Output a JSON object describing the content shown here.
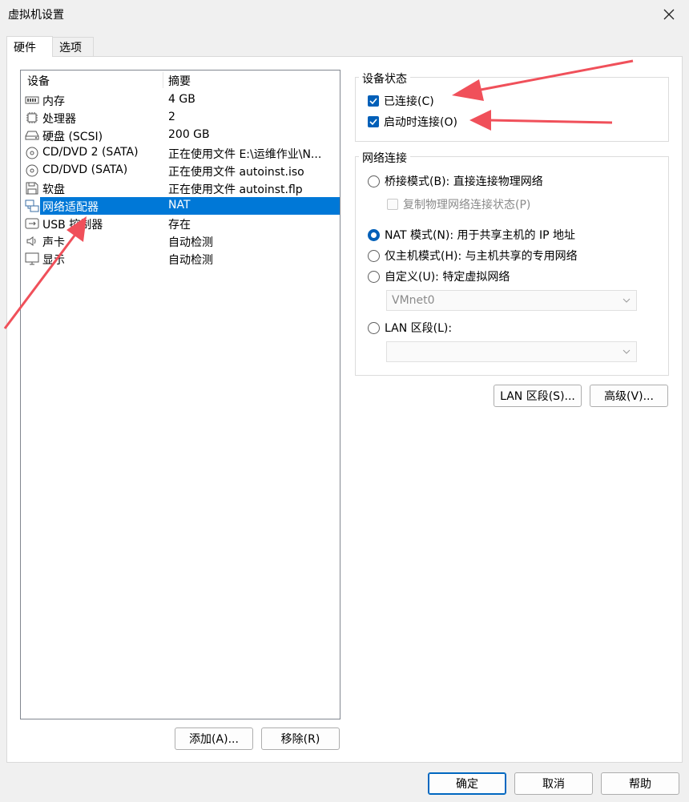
{
  "window": {
    "title": "虚拟机设置"
  },
  "tabs": [
    {
      "label": "硬件"
    },
    {
      "label": "选项"
    }
  ],
  "device_list": {
    "columns": {
      "device": "设备",
      "summary": "摘要"
    },
    "rows": [
      {
        "icon": "memory-icon",
        "name": "内存",
        "summary": "4 GB"
      },
      {
        "icon": "processor-icon",
        "name": "处理器",
        "summary": "2"
      },
      {
        "icon": "hard-disk-icon",
        "name": "硬盘 (SCSI)",
        "summary": "200 GB"
      },
      {
        "icon": "cd-dvd-icon",
        "name": "CD/DVD 2 (SATA)",
        "summary": "正在使用文件 E:\\运维作业\\N..."
      },
      {
        "icon": "cd-dvd-icon",
        "name": "CD/DVD (SATA)",
        "summary": "正在使用文件 autoinst.iso"
      },
      {
        "icon": "floppy-icon",
        "name": "软盘",
        "summary": "正在使用文件 autoinst.flp"
      },
      {
        "icon": "network-adapter-icon",
        "name": "网络适配器",
        "summary": "NAT",
        "selected": true
      },
      {
        "icon": "usb-icon",
        "name": "USB 控制器",
        "summary": "存在"
      },
      {
        "icon": "sound-icon",
        "name": "声卡",
        "summary": "自动检测"
      },
      {
        "icon": "display-icon",
        "name": "显示",
        "summary": "自动检测"
      }
    ],
    "add_button": "添加(A)...",
    "remove_button": "移除(R)"
  },
  "device_status": {
    "title": "设备状态",
    "connected": {
      "label": "已连接(C)",
      "checked": true
    },
    "connect_at_power_on": {
      "label": "启动时连接(O)",
      "checked": true
    }
  },
  "network_connection": {
    "title": "网络连接",
    "bridged": {
      "label": "桥接模式(B): 直接连接物理网络",
      "selected": false
    },
    "replicate": {
      "label": "复制物理网络连接状态(P)",
      "checked": false,
      "disabled": true
    },
    "nat": {
      "label": "NAT 模式(N): 用于共享主机的 IP 地址",
      "selected": true
    },
    "host_only": {
      "label": "仅主机模式(H): 与主机共享的专用网络",
      "selected": false
    },
    "custom": {
      "label": "自定义(U): 特定虚拟网络",
      "selected": false
    },
    "custom_select": {
      "value": "VMnet0"
    },
    "lan_segment": {
      "label": "LAN 区段(L):",
      "selected": false
    },
    "lan_select": {
      "value": ""
    }
  },
  "right_buttons": {
    "lan_segments": "LAN 区段(S)...",
    "advanced": "高级(V)..."
  },
  "footer": {
    "ok": "确定",
    "cancel": "取消",
    "help": "帮助"
  },
  "colors": {
    "accent": "#0078d7",
    "arrow": "#f0505a"
  }
}
